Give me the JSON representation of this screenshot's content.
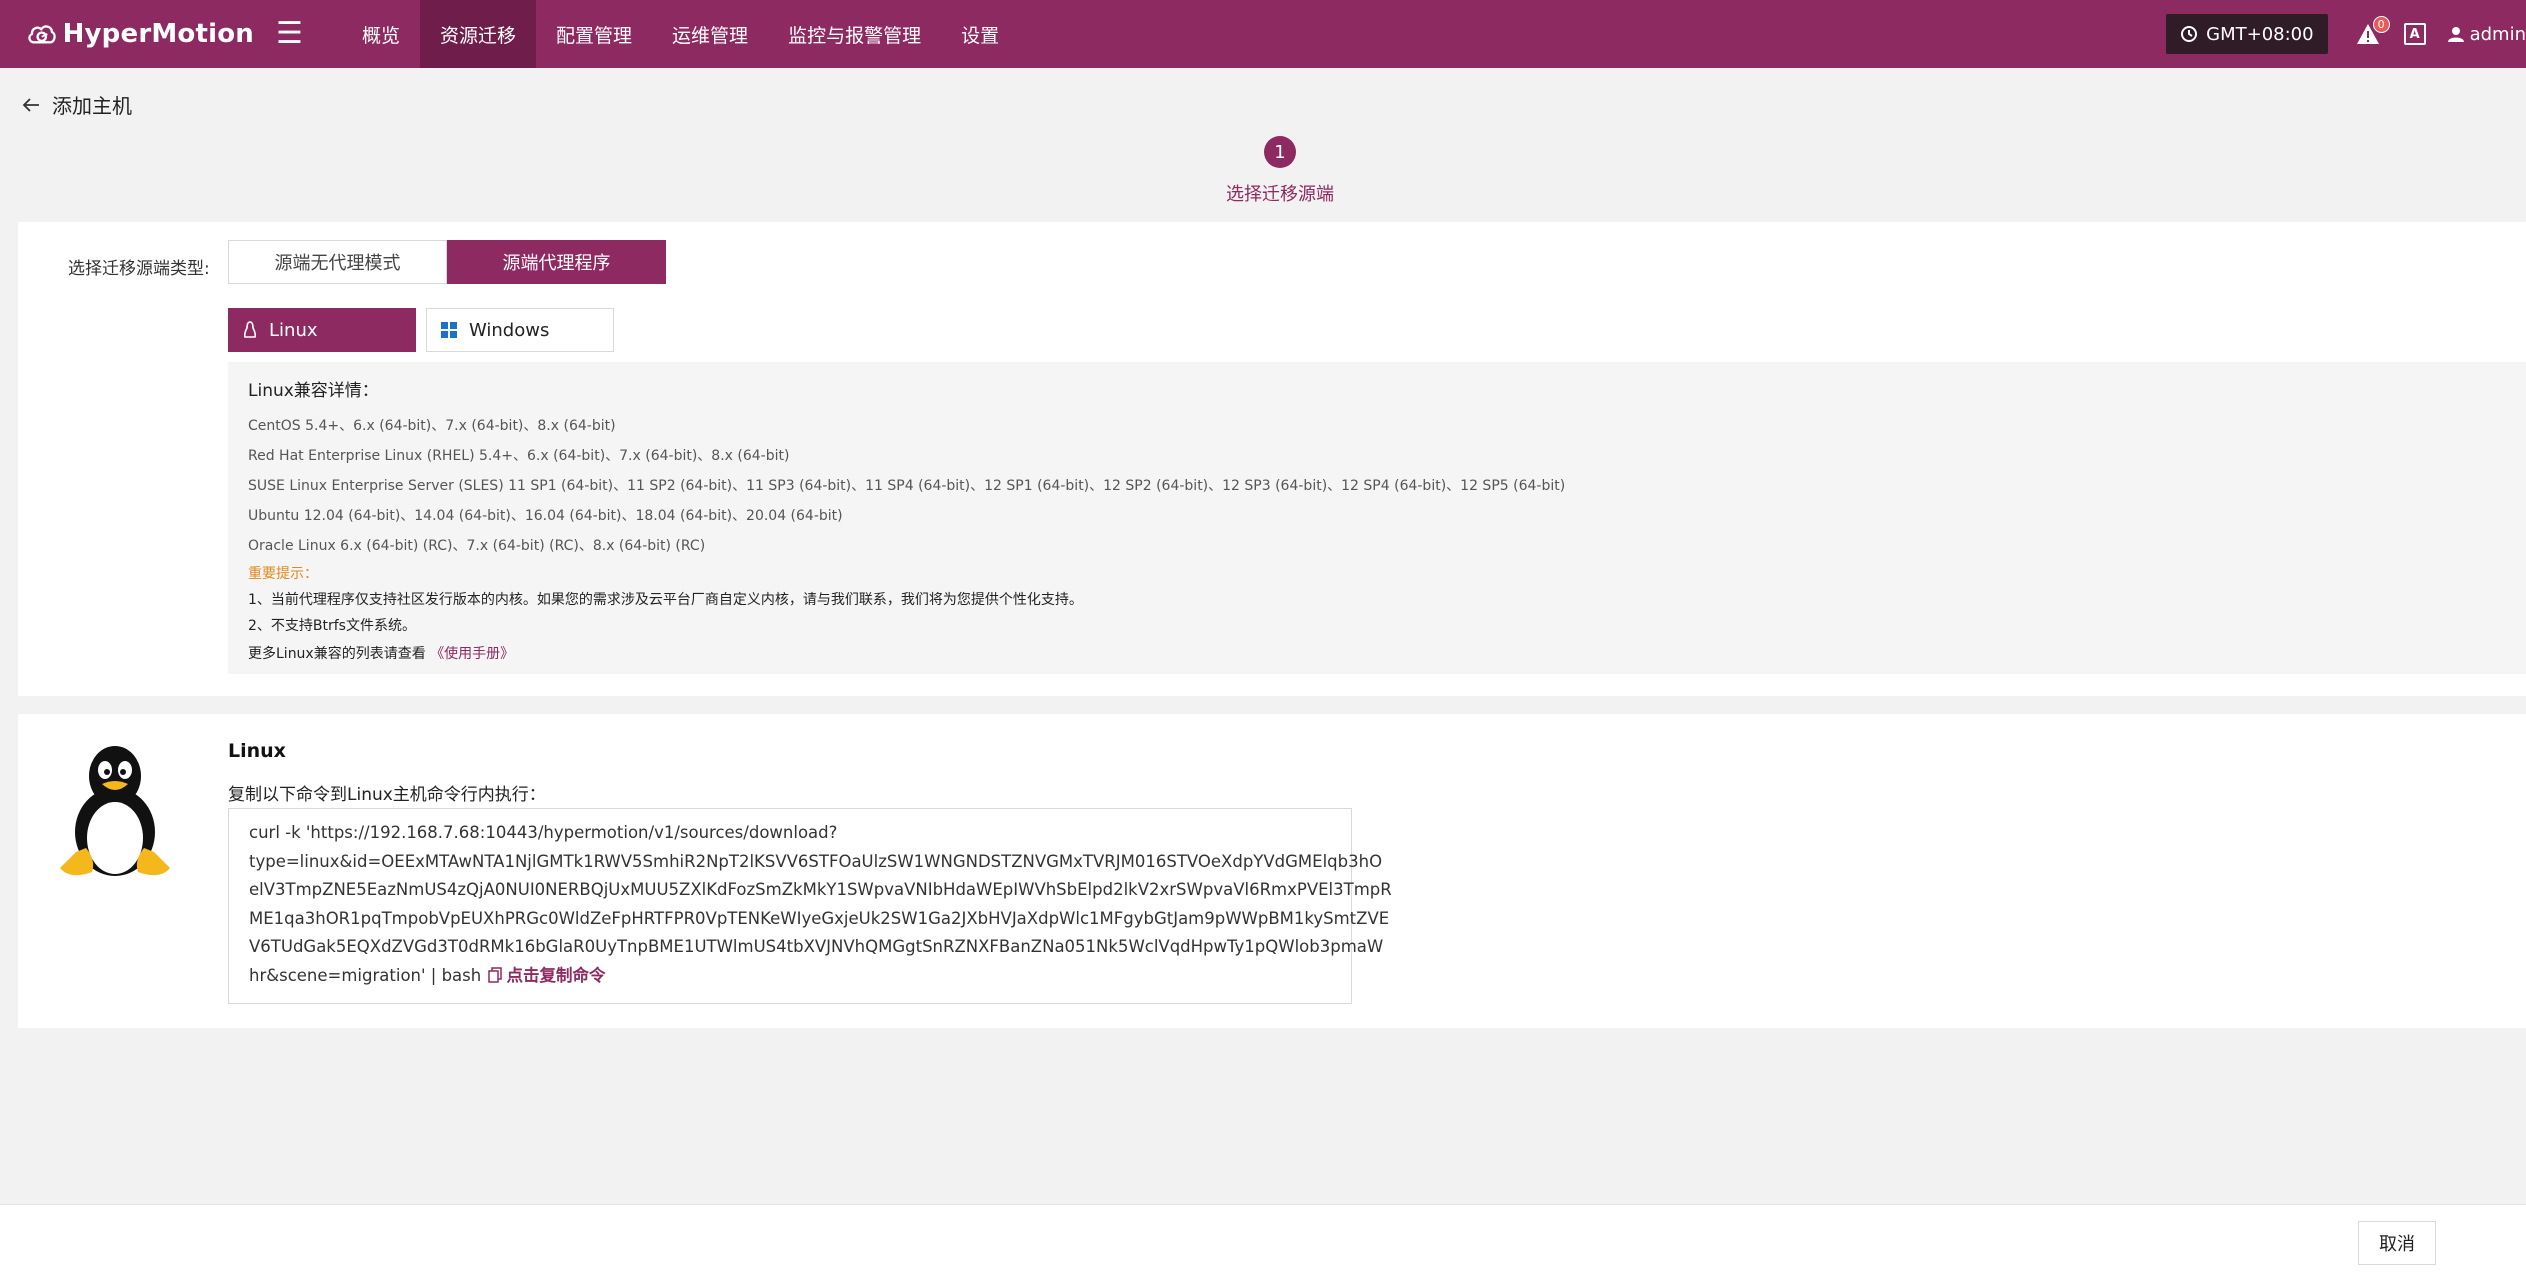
{
  "header": {
    "brand": "HyperMotion",
    "nav": [
      "概览",
      "资源迁移",
      "配置管理",
      "运维管理",
      "监控与报警管理",
      "设置"
    ],
    "active_nav": "资源迁移",
    "timezone": "GMT+08:00",
    "alert_count": "0",
    "lang_label": "A",
    "user": "admin"
  },
  "page": {
    "back_title": "添加主机",
    "step_number": "1",
    "step_label": "选择迁移源端"
  },
  "source": {
    "label": "选择迁移源端类型:",
    "options": [
      "源端无代理模式",
      "源端代理程序"
    ],
    "selected": "源端代理程序",
    "os_tabs": [
      "Linux",
      "Windows"
    ],
    "selected_os": "Linux"
  },
  "compat": {
    "title": "Linux兼容详情：",
    "lines": [
      "CentOS 5.4+、6.x (64-bit)、7.x (64-bit)、8.x (64-bit)",
      "Red Hat Enterprise Linux (RHEL) 5.4+、6.x (64-bit)、7.x (64-bit)、8.x (64-bit)",
      "SUSE Linux Enterprise Server (SLES) 11 SP1 (64-bit)、11 SP2 (64-bit)、11 SP3 (64-bit)、11 SP4 (64-bit)、12 SP1 (64-bit)、12 SP2 (64-bit)、12 SP3 (64-bit)、12 SP4 (64-bit)、12 SP5 (64-bit)",
      "Ubuntu 12.04 (64-bit)、14.04 (64-bit)、16.04 (64-bit)、18.04 (64-bit)、20.04 (64-bit)",
      "Oracle Linux 6.x (64-bit) (RC)、7.x (64-bit) (RC)、8.x (64-bit) (RC)"
    ],
    "tip_title": "重要提示：",
    "tips": [
      "1、当前代理程序仅支持社区发行版本的内核。如果您的需求涉及云平台厂商自定义内核，请与我们联系，我们将为您提供个性化支持。",
      "2、不支持Btrfs文件系统。"
    ],
    "more_prefix": "更多Linux兼容的列表请查看",
    "manual_link": "《使用手册》"
  },
  "install": {
    "title": "Linux",
    "instruction": "复制以下命令到Linux主机命令行内执行：",
    "command_lines": [
      "curl -k 'https://192.168.7.68:10443/hypermotion/v1/sources/download?",
      "type=linux&id=OEExMTAwNTA1NjlGMTk1RWV5SmhiR2NpT2lKSVV6STFOaUlzSW1WNGNDSTZNVGMxTVRJM016STVOeXdpYVdGMElqb3hO",
      "elV3TmpZNE5EazNmUS4zQjA0NUI0NERBQjUxMUU5ZXlKdFozSmZkMkY1SWpvaVNIbHdaWEpIWVhSbElpd2lkV2xrSWpvaVl6RmxPVEl3TmpR",
      "ME1qa3hOR1pqTmpobVpEUXhPRGc0WldZeFpHRTFPR0VpTENKeWIyeGxjeUk2SW1Ga2JXbHVJaXdpWlc1MFgybGtJam9pWWpBM1kySmtZVE",
      "V6TUdGak5EQXdZVGd3T0dRMk16bGlaR0UyTnpBME1UTWlmUS4tbXVJNVhQMGgtSnRZNXFBanZNa051Nk5WclVqdHpwTy1pQWlob3pmaW",
      "hr&scene=migration' | bash"
    ],
    "copy_label": "点击复制命令"
  },
  "footer": {
    "cancel_label": "取消"
  }
}
